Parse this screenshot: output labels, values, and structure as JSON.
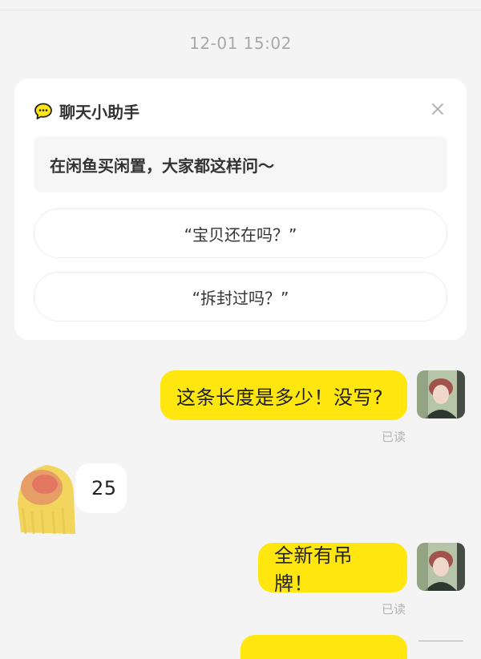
{
  "conversation": {
    "timestamp": "12-01 15:02"
  },
  "helper_card": {
    "title": "聊天小助手",
    "intro": "在闲鱼买闲置，大家都这样问～",
    "suggestions": [
      "“宝贝还在吗？”",
      "“拆封过吗？”"
    ],
    "icon": "chat-bubble-icon",
    "close_icon": "close-icon"
  },
  "messages": [
    {
      "direction": "outgoing",
      "text": "这条长度是多少！没写?",
      "status": "已读"
    },
    {
      "direction": "incoming",
      "text": "25"
    },
    {
      "direction": "outgoing",
      "text": "全新有吊牌！",
      "status": "已读"
    }
  ],
  "colors": {
    "background": "#f4f4f4",
    "outgoing_bubble": "#ffe60f",
    "incoming_bubble": "#ffffff",
    "card": "#ffffff",
    "muted_text": "#a9a9a9"
  }
}
